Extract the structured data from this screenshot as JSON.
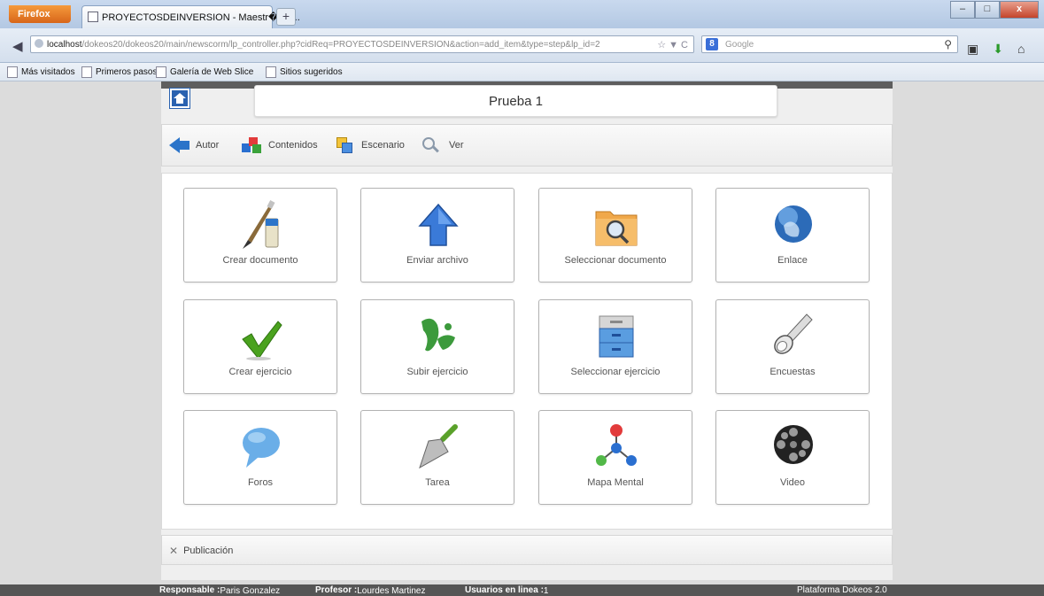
{
  "browser": {
    "menu_label": "Firefox",
    "tab_title": "PROYECTOSDEINVERSION - Maestr�a e...",
    "new_tab": "+",
    "url_host": "localhost",
    "url_rest": "/dokeos20/dokeos20/main/newscorm/lp_controller.php?cidReq=PROYECTOSDEINVERSION&action=add_item&type=step&lp_id=2",
    "search_placeholder": "Google",
    "bookmarks": [
      "Más visitados",
      "Primeros pasos",
      "Galería de Web Slice",
      "Sitios sugeridos"
    ]
  },
  "header": {
    "title": "Prueba 1"
  },
  "toolbar": {
    "items": [
      {
        "label": "Autor",
        "icon": "arrow-left-icon"
      },
      {
        "label": "Contenidos",
        "icon": "cubes-icon"
      },
      {
        "label": "Escenario",
        "icon": "scenario-icon"
      },
      {
        "label": "Ver",
        "icon": "magnifier-icon"
      }
    ]
  },
  "actions": [
    {
      "label": "Crear documento",
      "icon": "paint-brush-icon"
    },
    {
      "label": "Enviar archivo",
      "icon": "upload-arrow-icon"
    },
    {
      "label": "Seleccionar documento",
      "icon": "folder-search-icon"
    },
    {
      "label": "Enlace",
      "icon": "globe-icon"
    },
    {
      "label": "Crear ejercicio",
      "icon": "checkmark-icon"
    },
    {
      "label": "Subir ejercicio",
      "icon": "upload-exercise-icon"
    },
    {
      "label": "Seleccionar ejercicio",
      "icon": "cabinet-icon"
    },
    {
      "label": "Encuestas",
      "icon": "flashlight-icon"
    },
    {
      "label": "Foros",
      "icon": "speech-bubble-icon"
    },
    {
      "label": "Tarea",
      "icon": "trowel-icon"
    },
    {
      "label": "Mapa Mental",
      "icon": "molecule-icon"
    },
    {
      "label": "Video",
      "icon": "film-reel-icon"
    }
  ],
  "publication": {
    "label": "Publicación"
  },
  "footer": {
    "responsible_label": "Responsable :",
    "responsible_name": "Paris Gonzalez",
    "teacher_label": "Profesor :",
    "teacher_name": "Lourdes Martinez",
    "online_label": "Usuarios en linea :",
    "online_count": "1",
    "platform": "Plataforma Dokeos 2.0"
  },
  "colors": {
    "accent_blue": "#2b74c9",
    "footer_bg": "#555555",
    "check_green": "#4aa21e"
  }
}
